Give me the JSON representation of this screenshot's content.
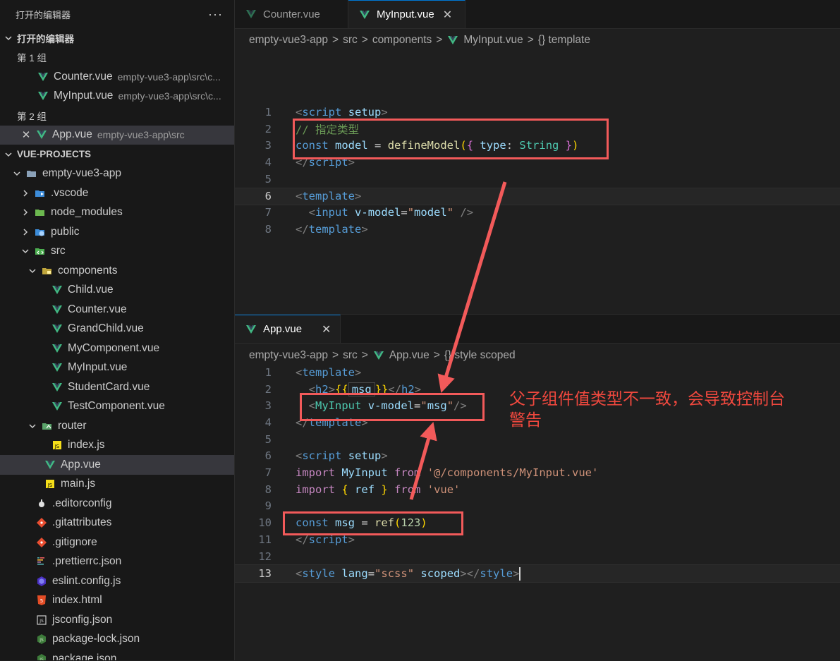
{
  "sidebar": {
    "header_title": "打开的编辑器",
    "header_more": "···",
    "open_editors_section": "打开的编辑器",
    "groups": [
      {
        "label": "第 1 组",
        "files": [
          {
            "name": "Counter.vue",
            "desc": "empty-vue3-app\\src\\c..."
          },
          {
            "name": "MyInput.vue",
            "desc": "empty-vue3-app\\src\\c..."
          }
        ]
      },
      {
        "label": "第 2 组",
        "files": [
          {
            "name": "App.vue",
            "desc": "empty-vue3-app\\src"
          }
        ]
      }
    ],
    "project_section": "VUE-PROJECTS",
    "tree": {
      "root": "empty-vue3-app",
      "vscode": ".vscode",
      "node_modules": "node_modules",
      "public": "public",
      "src": "src",
      "components": "components",
      "comp_files": [
        "Child.vue",
        "Counter.vue",
        "GrandChild.vue",
        "MyComponent.vue",
        "MyInput.vue",
        "StudentCard.vue",
        "TestComponent.vue"
      ],
      "router": "router",
      "router_index": "index.js",
      "app_vue": "App.vue",
      "main_js": "main.js",
      "editorconfig": ".editorconfig",
      "gitattributes": ".gitattributes",
      "gitignore": ".gitignore",
      "prettierrc": ".prettierrc.json",
      "eslint": "eslint.config.js",
      "index_html": "index.html",
      "jsconfig": "jsconfig.json",
      "package_lock": "package-lock.json",
      "package_json": "package.json"
    }
  },
  "editor_top": {
    "tabs": [
      {
        "label": "Counter.vue"
      },
      {
        "label": "MyInput.vue",
        "close": "✕"
      }
    ],
    "breadcrumb": [
      "empty-vue3-app",
      "src",
      "components",
      "MyInput.vue",
      "{} template"
    ],
    "line_numbers": [
      "1",
      "2",
      "3",
      "4",
      "5",
      "6",
      "7",
      "8"
    ]
  },
  "editor_bottom": {
    "tab_label": "App.vue",
    "tab_close": "✕",
    "breadcrumb": [
      "empty-vue3-app",
      "src",
      "App.vue",
      "{} style scoped"
    ],
    "line_numbers": [
      "1",
      "2",
      "3",
      "4",
      "5",
      "6",
      "7",
      "8",
      "9",
      "10",
      "11",
      "12",
      "13"
    ]
  },
  "annotation": {
    "line1": "父子组件值类型不一致，会导致控制台",
    "line2": "警告"
  },
  "colors": {
    "annotation_red": "#f25a5a",
    "vue_green": "#41b883",
    "active_tab_border": "#0078d4"
  }
}
